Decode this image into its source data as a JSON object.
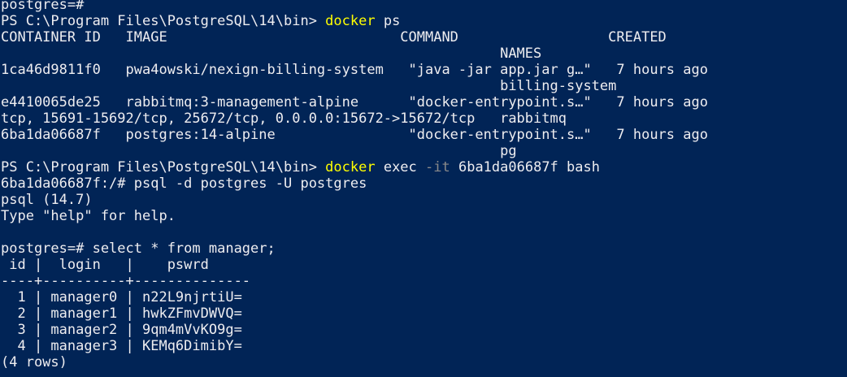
{
  "terminal": {
    "background": "#012456",
    "colors": {
      "normal": "#eeedf0",
      "cmd": "#ffff00",
      "param": "#8a8a8a"
    },
    "lines": [
      [
        {
          "t": "postgres=#",
          "s": "normal"
        }
      ],
      [
        {
          "t": "PS C:\\Program Files\\PostgreSQL\\14\\bin> ",
          "s": "normal"
        },
        {
          "t": "docker",
          "s": "cmd"
        },
        {
          "t": " ps",
          "s": "normal"
        }
      ],
      [
        {
          "t": "CONTAINER ID   IMAGE                            COMMAND                  CREATED",
          "s": "normal"
        }
      ],
      [
        {
          "t": "                                                            NAMES",
          "s": "normal"
        }
      ],
      [
        {
          "t": "1ca46d9811f0   pwa4owski/nexign-billing-system   \"java -jar app.jar g…\"   7 hours ago",
          "s": "normal"
        }
      ],
      [
        {
          "t": "                                                            billing-system",
          "s": "normal"
        }
      ],
      [
        {
          "t": "e4410065de25   rabbitmq:3-management-alpine      \"docker-entrypoint.s…\"   7 hours ago",
          "s": "normal"
        }
      ],
      [
        {
          "t": "tcp, 15691-15692/tcp, 25672/tcp, 0.0.0.0:15672->15672/tcp   rabbitmq",
          "s": "normal"
        }
      ],
      [
        {
          "t": "6ba1da06687f   postgres:14-alpine                \"docker-entrypoint.s…\"   7 hours ago",
          "s": "normal"
        }
      ],
      [
        {
          "t": "                                                            pg",
          "s": "normal"
        }
      ],
      [
        {
          "t": "PS C:\\Program Files\\PostgreSQL\\14\\bin> ",
          "s": "normal"
        },
        {
          "t": "docker",
          "s": "cmd"
        },
        {
          "t": " exec ",
          "s": "normal"
        },
        {
          "t": "-it",
          "s": "param"
        },
        {
          "t": " 6ba1da06687f bash",
          "s": "normal"
        }
      ],
      [
        {
          "t": "6ba1da06687f:/# psql -d postgres -U postgres",
          "s": "normal"
        }
      ],
      [
        {
          "t": "psql (14.7)",
          "s": "normal"
        }
      ],
      [
        {
          "t": "Type \"help\" for help.",
          "s": "normal"
        }
      ],
      [
        {
          "t": "",
          "s": "normal"
        }
      ],
      [
        {
          "t": "postgres=# select * from manager;",
          "s": "normal"
        }
      ],
      [
        {
          "t": " id |  login   |    pswrd",
          "s": "normal"
        }
      ],
      [
        {
          "t": "----+----------+--------------",
          "s": "normal"
        }
      ],
      [
        {
          "t": "  1 | manager0 | n22L9njrtiU=",
          "s": "normal"
        }
      ],
      [
        {
          "t": "  2 | manager1 | hwkZFmvDWVQ=",
          "s": "normal"
        }
      ],
      [
        {
          "t": "  3 | manager2 | 9qm4mVvKO9g=",
          "s": "normal"
        }
      ],
      [
        {
          "t": "  4 | manager3 | KEMq6DimibY=",
          "s": "normal"
        }
      ],
      [
        {
          "t": "(4 rows)",
          "s": "normal"
        }
      ]
    ]
  }
}
